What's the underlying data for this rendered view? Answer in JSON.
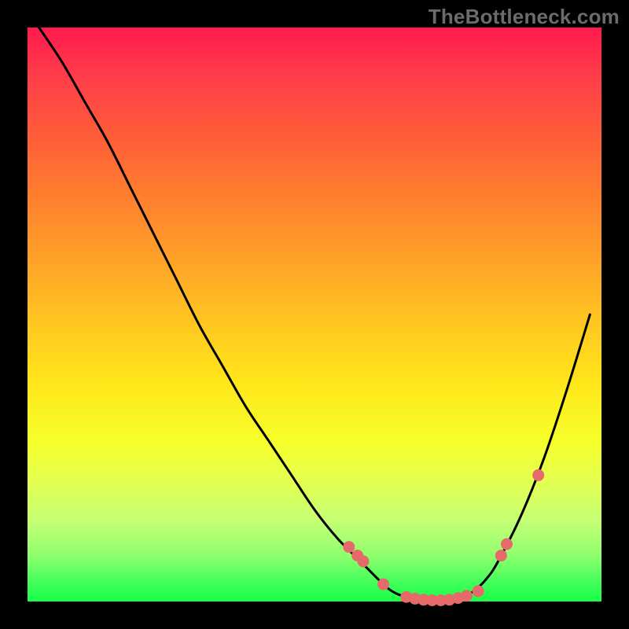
{
  "watermark": "TheBottleneck.com",
  "colors": {
    "background": "#000000",
    "curve": "#000000",
    "marker": "#e66a6a",
    "gradient_top": "#ff1a4d",
    "gradient_bottom": "#18ff46"
  },
  "chart_data": {
    "type": "line",
    "title": "",
    "xlabel": "",
    "ylabel": "",
    "xlim": [
      0,
      100
    ],
    "ylim": [
      0,
      100
    ],
    "x": [
      2,
      6,
      10,
      14,
      18,
      22,
      26,
      30,
      34,
      38,
      42,
      46,
      50,
      54,
      58,
      62,
      64,
      66,
      68,
      70,
      72,
      74,
      76,
      78,
      80,
      82,
      86,
      90,
      94,
      98
    ],
    "y": [
      100,
      94,
      87,
      80,
      72,
      64,
      56,
      48,
      41,
      34,
      28,
      22,
      16,
      11,
      7,
      3,
      1.5,
      0.8,
      0.3,
      0.1,
      0.1,
      0.3,
      0.8,
      2,
      4,
      7,
      15,
      25,
      37,
      50
    ],
    "markers": {
      "x": [
        56,
        57.5,
        58.5,
        62,
        66,
        67.5,
        69,
        70.5,
        72,
        73.5,
        75,
        76.5,
        78.5,
        82.5,
        83.5,
        89
      ],
      "y": [
        9.5,
        8,
        7,
        3,
        0.8,
        0.5,
        0.3,
        0.2,
        0.2,
        0.3,
        0.6,
        1.0,
        1.8,
        8,
        10,
        22
      ]
    }
  }
}
